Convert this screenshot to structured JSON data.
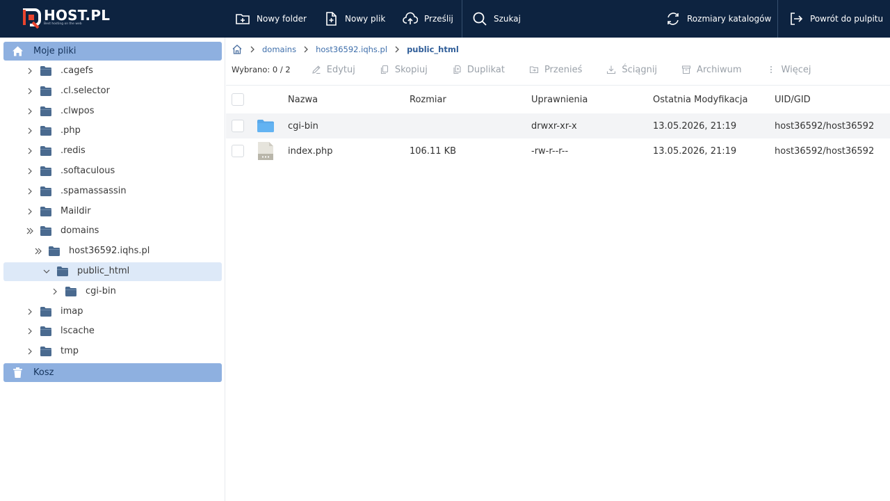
{
  "brand": {
    "name": "HOST.PL",
    "tagline": "Best hosting on the web"
  },
  "toolbar": {
    "new_folder": "Nowy folder",
    "new_file": "Nowy plik",
    "upload": "Prześlij",
    "search": "Szukaj",
    "dir_sizes": "Rozmiary katalogów",
    "back_to_panel": "Powrót do pulpitu"
  },
  "sidebar": {
    "root_label": "Moje pliki",
    "tree": [
      {
        "label": ".cagefs"
      },
      {
        "label": ".cl.selector"
      },
      {
        "label": ".clwpos"
      },
      {
        "label": ".php"
      },
      {
        "label": ".redis"
      },
      {
        "label": ".softaculous"
      },
      {
        "label": ".spamassassin"
      },
      {
        "label": "Maildir"
      },
      {
        "label": "domains"
      },
      {
        "label": "host36592.iqhs.pl"
      },
      {
        "label": "public_html"
      },
      {
        "label": "cgi-bin"
      },
      {
        "label": "imap"
      },
      {
        "label": "lscache"
      },
      {
        "label": "tmp"
      }
    ],
    "trash_label": "Kosz"
  },
  "breadcrumb": {
    "items": [
      "domains",
      "host36592.iqhs.pl"
    ],
    "current": "public_html"
  },
  "actions": {
    "selected": "Wybrano: 0 / 2",
    "edit": "Edytuj",
    "copy": "Skopiuj",
    "duplicate": "Duplikat",
    "move": "Przenieś",
    "download": "Ściągnij",
    "archive": "Archiwum",
    "more": "Więcej"
  },
  "table": {
    "columns": {
      "name": "Nazwa",
      "size": "Rozmiar",
      "permissions": "Uprawnienia",
      "modified": "Ostatnia Modyfikacja",
      "owner": "UID/GID"
    },
    "rows": [
      {
        "name": "cgi-bin",
        "size": "",
        "permissions": "drwxr-xr-x",
        "modified": "13.05.2026, 21:19",
        "owner": "host36592/host36592",
        "icon": "folder-icon"
      },
      {
        "name": "index.php",
        "size": "106.11 KB",
        "permissions": "-rw-r--r--",
        "modified": "13.05.2026, 21:19",
        "owner": "host36592/host36592",
        "icon": "file-icon"
      }
    ]
  },
  "colors": {
    "topbar": "#0d2340",
    "accent": "#e9442e",
    "selection": "#8eb0e0",
    "folder": "#4a6a8f",
    "folder_light": "#5aa9ea"
  }
}
